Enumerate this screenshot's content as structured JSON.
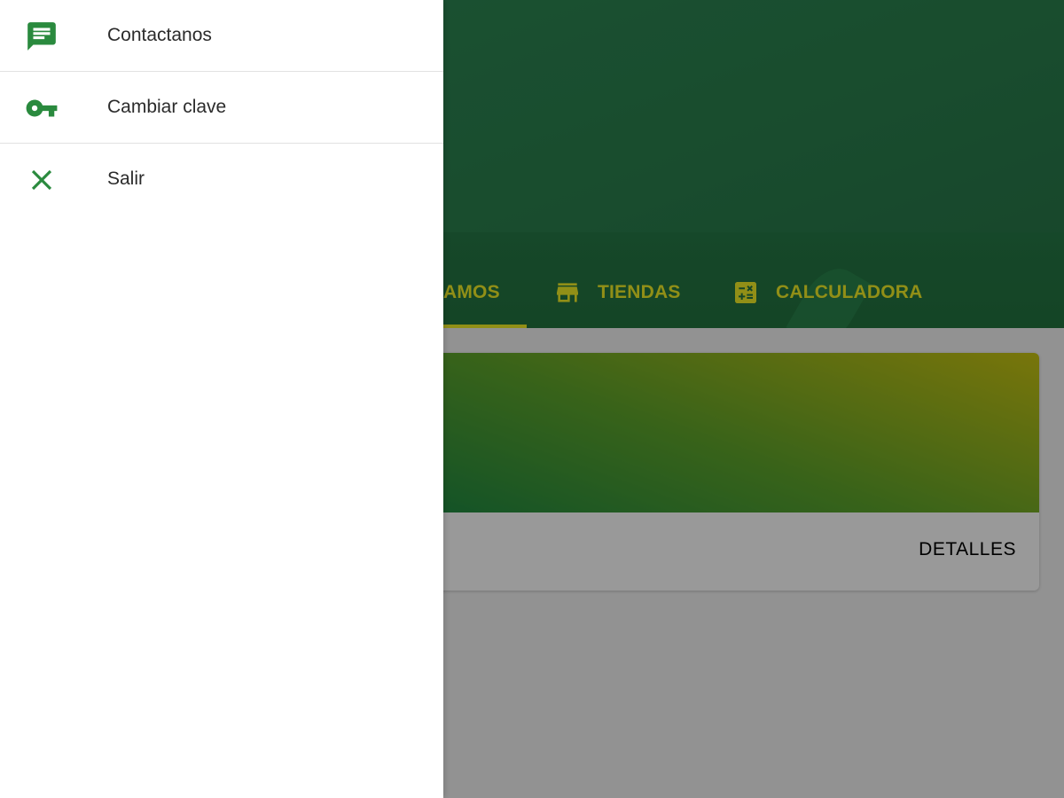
{
  "drawer": {
    "items": [
      {
        "label": "Contactanos",
        "icon": "chat-message-icon"
      },
      {
        "label": "Cambiar clave",
        "icon": "key-icon"
      },
      {
        "label": "Salir",
        "icon": "close-icon"
      }
    ]
  },
  "app": {
    "tabs": [
      {
        "label": "AMOS",
        "active": true
      },
      {
        "label": "TIENDAS",
        "icon": "store-icon"
      },
      {
        "label": "CALCULADORA",
        "icon": "calculator-icon"
      }
    ],
    "card": {
      "action_label": "DETALLES"
    }
  },
  "colors": {
    "primary": "#2a7f4d",
    "accent": "#f2ee27",
    "drawer_icon": "#2a8a3e"
  }
}
